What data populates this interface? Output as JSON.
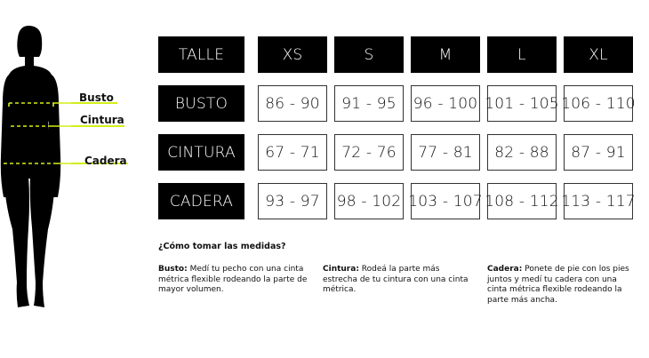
{
  "figure": {
    "labels": [
      "Busto",
      "Cintura",
      "Cadera"
    ],
    "accent_color": "#d4ee19"
  },
  "table": {
    "header": [
      "TALLE",
      "XS",
      "S",
      "M",
      "L",
      "XL"
    ],
    "rows": [
      {
        "label": "BUSTO",
        "values": [
          "86 - 90",
          "91 - 95",
          "96 - 100",
          "101 - 105",
          "106 - 110"
        ]
      },
      {
        "label": "CINTURA",
        "values": [
          "67 - 71",
          "72 - 76",
          "77 - 81",
          "82 - 88",
          "87 - 91"
        ]
      },
      {
        "label": "CADERA",
        "values": [
          "93 - 97",
          "98 - 102",
          "103 - 107",
          "108 - 112",
          "113 - 117"
        ]
      }
    ]
  },
  "howto": {
    "title": "¿Cómo tomar las medidas?",
    "notes": [
      {
        "term": "Busto:",
        "text": "Medí tu pecho con una cinta métrica flexible rodeando la parte de mayor volumen."
      },
      {
        "term": "Cintura:",
        "text": "Rodeá la parte más estrecha de tu cintura con una cinta métrica."
      },
      {
        "term": "Cadera:",
        "text": "Ponete de pie con los pies juntos y medí tu cadera con una cinta métrica flexible rodeando la parte más ancha."
      }
    ]
  }
}
